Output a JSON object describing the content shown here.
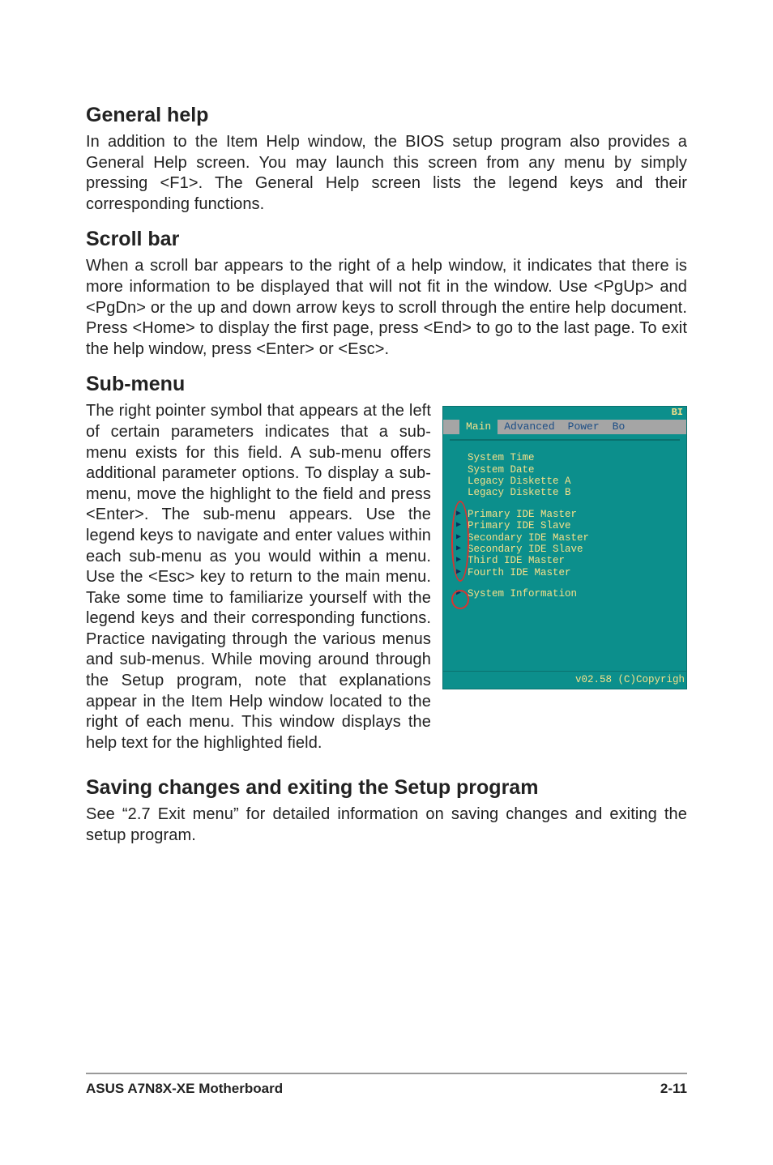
{
  "sections": {
    "general_help": {
      "heading": "General help",
      "body": "In addition to the Item Help window, the BIOS setup program also provides a General Help screen. You may launch this screen from any menu by simply pressing <F1>. The General Help screen lists the legend keys and their corresponding functions."
    },
    "scroll_bar": {
      "heading": "Scroll bar",
      "body": "When a scroll bar appears to the right of a help window, it indicates that there is more information to be displayed that will not fit in the window. Use <PgUp> and <PgDn> or the up and down arrow keys to scroll through the entire help document. Press <Home> to display the first page, press <End> to go to the last page. To exit the help window, press <Enter> or <Esc>."
    },
    "sub_menu": {
      "heading": "Sub-menu",
      "body": "The right pointer symbol that appears at the left of certain parameters indicates that a sub-menu exists  for this field. A sub-menu offers additional parameter options. To display a sub-menu, move the highlight to the field and press <Enter>. The sub-menu appears. Use the legend keys to navigate and enter values within each sub-menu as you would within a menu. Use the <Esc> key to return to the main menu. Take some time to familiarize yourself with the legend keys and their corresponding functions. Practice navigating through the various menus and sub-menus. While moving around through the Setup program, note that explanations appear in the Item Help window located to the right of each menu. This window displays the help text for the highlighted field."
    },
    "saving": {
      "heading": "Saving changes and exiting the Setup program",
      "body": "See “2.7 Exit menu” for detailed information on saving changes and exiting the setup program."
    }
  },
  "bios": {
    "header_right": "BI",
    "tabs": {
      "main": "Main",
      "advanced": "Advanced",
      "power": "Power",
      "boot_partial": "Bo"
    },
    "items_top": [
      "System Time",
      "System Date",
      "Legacy Diskette A",
      "Legacy Diskette B"
    ],
    "items_sub": [
      "Primary IDE Master",
      "Primary IDE Slave",
      "Secondary IDE Master",
      "Secondary IDE Slave",
      "Third IDE Master",
      "Fourth IDE Master"
    ],
    "items_sub2": [
      "System Information"
    ],
    "footer": "v02.58 (C)Copyrigh"
  },
  "page_footer": {
    "product": "ASUS A7N8X-XE Motherboard",
    "page_number": "2-11"
  }
}
